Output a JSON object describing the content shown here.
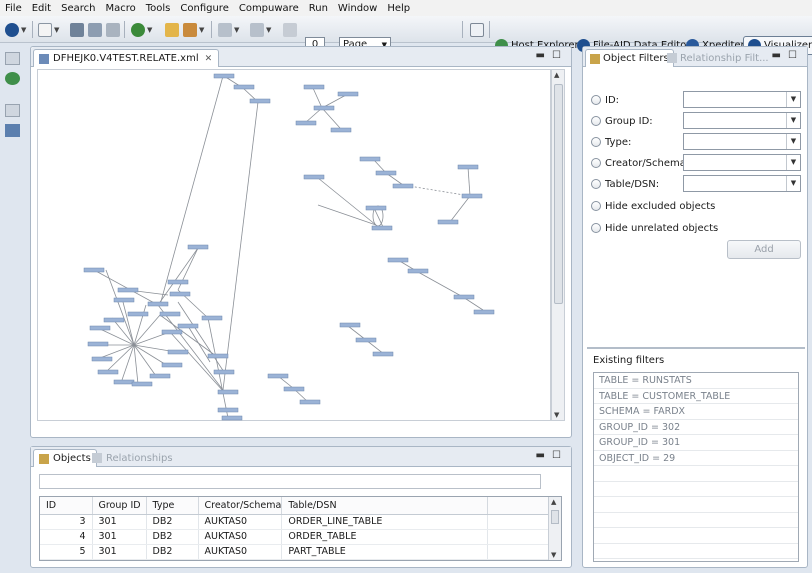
{
  "menu": [
    "File",
    "Edit",
    "Search",
    "Macro",
    "Tools",
    "Configure",
    "Compuware",
    "Run",
    "Window",
    "Help"
  ],
  "toolbar": {
    "page_number": "0",
    "zoom_mode": "Page",
    "perspectives": [
      {
        "label": "Host Explorer",
        "icon": "host-explorer-icon"
      },
      {
        "label": "File-AID Data Editor",
        "icon": "file-aid-icon"
      },
      {
        "label": "Xpediter",
        "icon": "xpediter-icon"
      },
      {
        "label": "Visualizer",
        "icon": "visualizer-icon"
      }
    ]
  },
  "editor": {
    "tab_title": "DFHEJK0.V4TEST.RELATE.xml"
  },
  "objects_view": {
    "tabs": [
      "Objects",
      "Relationships"
    ],
    "columns": [
      "ID",
      "Group ID",
      "Type",
      "Creator/Schema",
      "Table/DSN"
    ],
    "rows": [
      [
        "3",
        "301",
        "DB2",
        "AUKTAS0",
        "ORDER_LINE_TABLE"
      ],
      [
        "4",
        "301",
        "DB2",
        "AUKTAS0",
        "ORDER_TABLE"
      ],
      [
        "5",
        "301",
        "DB2",
        "AUKTAS0",
        "PART_TABLE"
      ]
    ]
  },
  "filters_view": {
    "tabs": [
      "Object Filters",
      "Relationship Filt..."
    ],
    "fields": [
      "ID:",
      "Group ID:",
      "Type:",
      "Creator/Schema:",
      "Table/DSN:"
    ],
    "options": [
      "Hide excluded objects",
      "Hide unrelated objects"
    ],
    "add_label": "Add",
    "existing_label": "Existing filters",
    "existing": [
      "TABLE = RUNSTATS",
      "TABLE = CUSTOMER_TABLE",
      "SCHEMA = FARDX",
      "GROUP_ID = 302",
      "GROUP_ID = 301",
      "OBJECT_ID = 29"
    ]
  },
  "colors": {
    "accent": "#1f5fa8",
    "node": "#9bb3d6",
    "panel_border": "#a9b6c5"
  }
}
